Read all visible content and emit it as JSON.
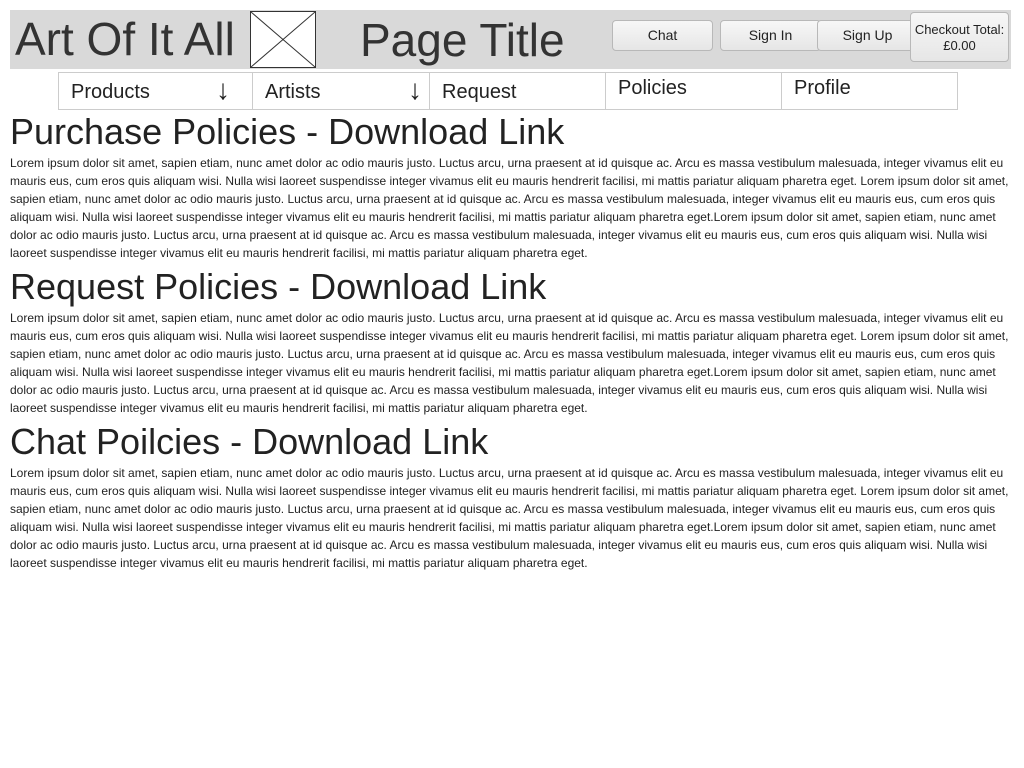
{
  "header": {
    "site_title": "Art Of It All",
    "page_title": "Page Title",
    "buttons": {
      "chat": "Chat",
      "sign_in": "Sign In",
      "sign_up": "Sign Up"
    },
    "checkout": {
      "label": "Checkout Total:",
      "amount": "£0.00"
    }
  },
  "nav": {
    "items": [
      {
        "label": "Products",
        "icon": "arrow-down-icon"
      },
      {
        "label": "Artists",
        "icon": "arrow-down-icon"
      },
      {
        "label": "Request"
      },
      {
        "label": "Policies"
      },
      {
        "label": "Profile"
      }
    ],
    "arrow_glyph": "↓"
  },
  "sections": [
    {
      "heading": "Purchase Policies - Download Link",
      "body": "Lorem ipsum dolor sit amet, sapien etiam, nunc amet dolor ac odio mauris justo. Luctus arcu, urna praesent at id quisque ac. Arcu es massa vestibulum malesuada, integer vivamus elit eu mauris eus, cum eros quis aliquam wisi. Nulla wisi laoreet suspendisse integer vivamus elit eu mauris hendrerit facilisi, mi mattis pariatur aliquam pharetra eget. Lorem ipsum dolor sit amet, sapien etiam, nunc amet dolor ac odio mauris justo. Luctus arcu, urna praesent at id quisque ac. Arcu es massa vestibulum malesuada, integer vivamus elit eu mauris eus, cum eros quis aliquam wisi. Nulla wisi laoreet suspendisse integer vivamus elit eu mauris hendrerit facilisi, mi mattis pariatur aliquam pharetra eget.Lorem ipsum dolor sit amet, sapien etiam, nunc amet dolor ac odio mauris justo. Luctus arcu, urna praesent at id quisque ac. Arcu es massa vestibulum malesuada, integer vivamus elit eu mauris eus, cum eros quis aliquam wisi. Nulla wisi laoreet suspendisse integer vivamus elit eu mauris hendrerit facilisi, mi mattis pariatur aliquam pharetra eget."
    },
    {
      "heading": "Request Policies - Download Link",
      "body": "Lorem ipsum dolor sit amet, sapien etiam, nunc amet dolor ac odio mauris justo. Luctus arcu, urna praesent at id quisque ac. Arcu es massa vestibulum malesuada, integer vivamus elit eu mauris eus, cum eros quis aliquam wisi. Nulla wisi laoreet suspendisse integer vivamus elit eu mauris hendrerit facilisi, mi mattis pariatur aliquam pharetra eget. Lorem ipsum dolor sit amet, sapien etiam, nunc amet dolor ac odio mauris justo. Luctus arcu, urna praesent at id quisque ac. Arcu es massa vestibulum malesuada, integer vivamus elit eu mauris eus, cum eros quis aliquam wisi. Nulla wisi laoreet suspendisse integer vivamus elit eu mauris hendrerit facilisi, mi mattis pariatur aliquam pharetra eget.Lorem ipsum dolor sit amet, sapien etiam, nunc amet dolor ac odio mauris justo. Luctus arcu, urna praesent at id quisque ac. Arcu es massa vestibulum malesuada, integer vivamus elit eu mauris eus, cum eros quis aliquam wisi. Nulla wisi laoreet suspendisse integer vivamus elit eu mauris hendrerit facilisi, mi mattis pariatur aliquam pharetra eget."
    },
    {
      "heading": "Chat Poilcies - Download Link",
      "body": "Lorem ipsum dolor sit amet, sapien etiam, nunc amet dolor ac odio mauris justo. Luctus arcu, urna praesent at id quisque ac. Arcu es massa vestibulum malesuada, integer vivamus elit eu mauris eus, cum eros quis aliquam wisi. Nulla wisi laoreet suspendisse integer vivamus elit eu mauris hendrerit facilisi, mi mattis pariatur aliquam pharetra eget. Lorem ipsum dolor sit amet, sapien etiam, nunc amet dolor ac odio mauris justo. Luctus arcu, urna praesent at id quisque ac. Arcu es massa vestibulum malesuada, integer vivamus elit eu mauris eus, cum eros quis aliquam wisi. Nulla wisi laoreet suspendisse integer vivamus elit eu mauris hendrerit facilisi, mi mattis pariatur aliquam pharetra eget.Lorem ipsum dolor sit amet, sapien etiam, nunc amet dolor ac odio mauris justo. Luctus arcu, urna praesent at id quisque ac. Arcu es massa vestibulum malesuada, integer vivamus elit eu mauris eus, cum eros quis aliquam wisi. Nulla wisi laoreet suspendisse integer vivamus elit eu mauris hendrerit facilisi, mi mattis pariatur aliquam pharetra eget."
    }
  ],
  "colors": {
    "header_bg": "#d9d9d9",
    "text": "#222222",
    "border": "#cccccc"
  }
}
